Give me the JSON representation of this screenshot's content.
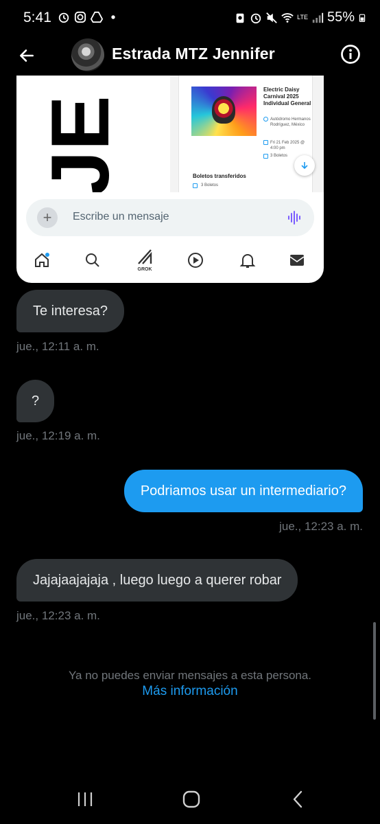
{
  "status_bar": {
    "time": "5:41",
    "battery_percent": "55%",
    "network_label": "LTE"
  },
  "header": {
    "contact_name": "Estrada MTZ Jennifer"
  },
  "shared_image": {
    "ticket_title": "Electric Daisy Carnival 2025 Individual General",
    "ticket_location": "Autódromo Hermanos Rodríguez, México",
    "ticket_date": "Fri 21 Feb 2025 @ 4:00 pm",
    "ticket_count": "3 Boletos",
    "transfer_title": "Boletos transferidos",
    "transfer_count": "3 Boletos",
    "compose_placeholder": "Escribe un mensaje",
    "grok_label": "GROK"
  },
  "messages": [
    {
      "direction": "incoming",
      "text": "Te interesa?",
      "time": "jue., 12:11 a. m."
    },
    {
      "direction": "incoming",
      "text": "?",
      "time": "jue., 12:19 a. m."
    },
    {
      "direction": "outgoing",
      "text": "Podriamos usar un intermediario?",
      "time": "jue., 12:23 a. m."
    },
    {
      "direction": "incoming",
      "text": "Jajajaajajaja , luego luego a querer robar",
      "time": "jue., 12:23 a. m."
    }
  ],
  "notice": {
    "text": "Ya no puedes enviar mensajes a esta persona.",
    "link": "Más información"
  },
  "colors": {
    "accent": "#1d9bf0",
    "incoming_bubble": "#2f3336",
    "timestamp": "#71767b",
    "background": "#000000"
  },
  "icons": [
    "back-arrow-icon",
    "info-icon",
    "home-icon",
    "search-icon",
    "grok-icon",
    "play-icon",
    "bell-icon",
    "mail-icon",
    "plus-icon",
    "voice-icon",
    "recents-icon",
    "home-circle-icon",
    "nav-back-icon"
  ]
}
